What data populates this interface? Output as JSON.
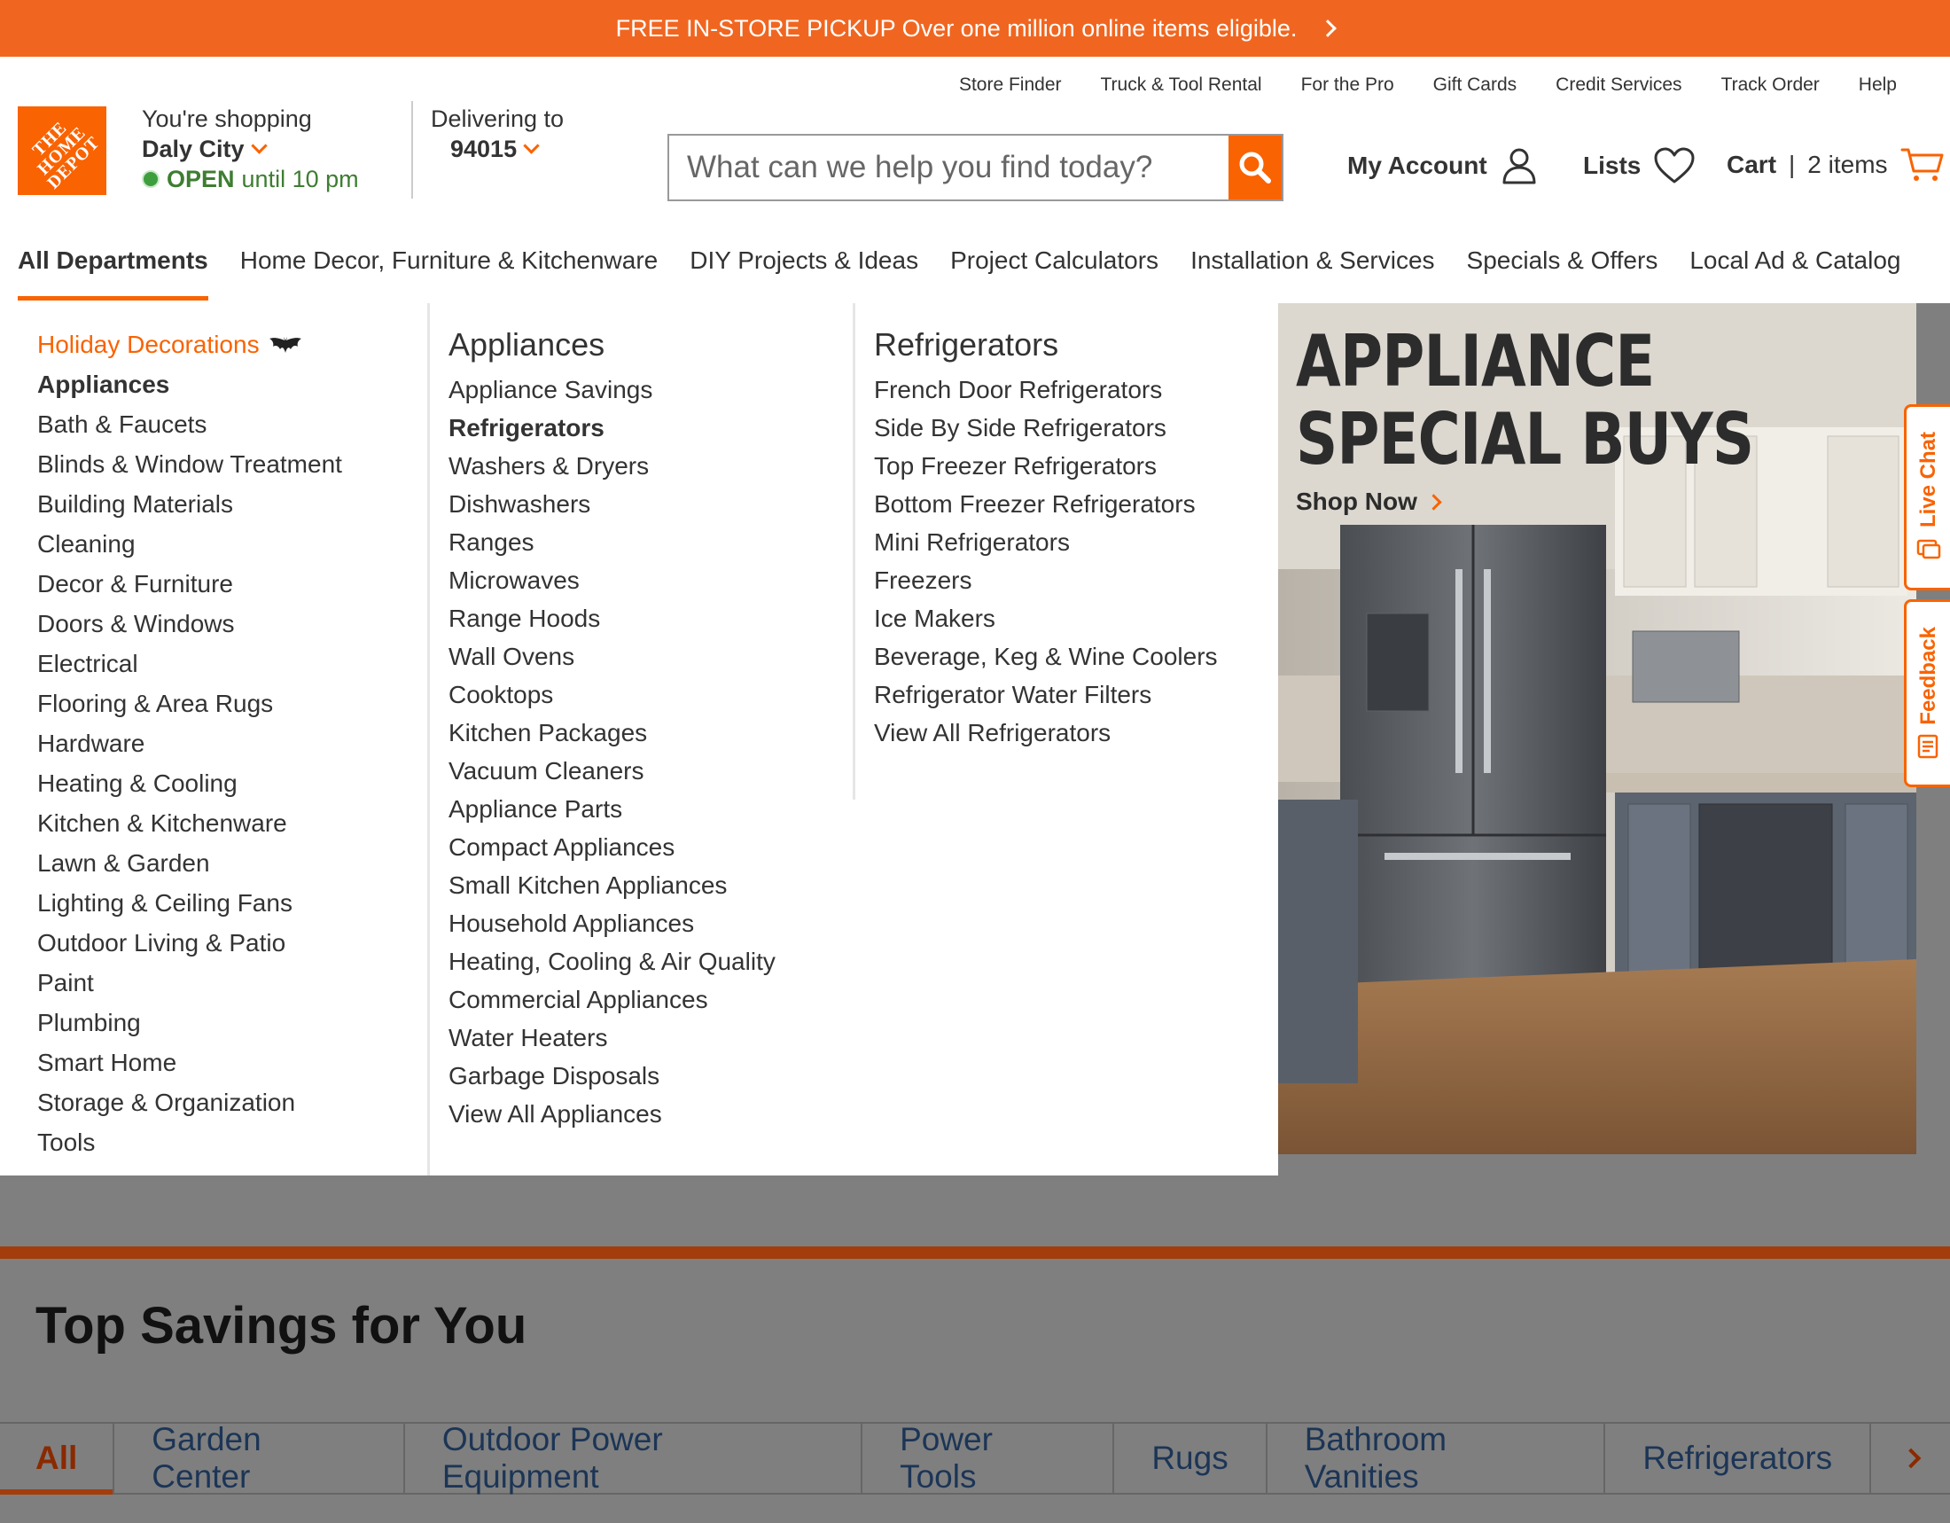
{
  "promo_bar": {
    "text": "FREE IN-STORE PICKUP Over one million online items eligible."
  },
  "utility_links": [
    "Store Finder",
    "Truck & Tool Rental",
    "For the Pro",
    "Gift Cards",
    "Credit Services",
    "Track Order",
    "Help"
  ],
  "logo": {
    "text": "THE HOME DEPOT"
  },
  "store": {
    "label": "You're shopping",
    "city": "Daly City",
    "status": "OPEN",
    "hours": "until 10 pm"
  },
  "delivery": {
    "label": "Delivering to",
    "zip": "94015"
  },
  "search": {
    "placeholder": "What can we help you find today?"
  },
  "account": {
    "my_account": "My Account",
    "lists": "Lists",
    "cart": "Cart",
    "cart_sep": "|",
    "cart_count": "2 items"
  },
  "nav": [
    "All Departments",
    "Home Decor, Furniture & Kitchenware",
    "DIY Projects & Ideas",
    "Project Calculators",
    "Installation & Services",
    "Specials & Offers",
    "Local Ad & Catalog"
  ],
  "departments": [
    "Holiday Decorations",
    "Appliances",
    "Bath & Faucets",
    "Blinds & Window Treatment",
    "Building Materials",
    "Cleaning",
    "Decor & Furniture",
    "Doors & Windows",
    "Electrical",
    "Flooring & Area Rugs",
    "Hardware",
    "Heating & Cooling",
    "Kitchen & Kitchenware",
    "Lawn & Garden",
    "Lighting & Ceiling Fans",
    "Outdoor Living & Patio",
    "Paint",
    "Plumbing",
    "Smart Home",
    "Storage & Organization",
    "Tools"
  ],
  "appliances": {
    "heading": "Appliances",
    "items": [
      "Appliance Savings",
      "Refrigerators",
      "Washers & Dryers",
      "Dishwashers",
      "Ranges",
      "Microwaves",
      "Range Hoods",
      "Wall Ovens",
      "Cooktops",
      "Kitchen Packages",
      "Vacuum Cleaners",
      "Appliance Parts",
      "Compact Appliances",
      "Small Kitchen Appliances",
      "Household Appliances",
      "Heating, Cooling & Air Quality",
      "Commercial Appliances",
      "Water Heaters",
      "Garbage Disposals",
      "View All Appliances"
    ]
  },
  "refrigerators": {
    "heading": "Refrigerators",
    "items": [
      "French Door Refrigerators",
      "Side By Side Refrigerators",
      "Top Freezer Refrigerators",
      "Bottom Freezer Refrigerators",
      "Mini Refrigerators",
      "Freezers",
      "Ice Makers",
      "Beverage, Keg & Wine Coolers",
      "Refrigerator Water Filters",
      "View All Refrigerators"
    ]
  },
  "promo_image": {
    "line1": "APPLIANCE",
    "line2": "SPECIAL BUYS",
    "cta": "Shop Now"
  },
  "side_tabs": {
    "live_chat": "Live Chat",
    "feedback": "Feedback"
  },
  "savings": {
    "title": "Top Savings for You",
    "tabs": [
      "All",
      "Garden Center",
      "Outdoor Power Equipment",
      "Power Tools",
      "Rugs",
      "Bathroom Vanities",
      "Refrigerators"
    ]
  },
  "colors": {
    "brand_orange": "#f96302",
    "open_green": "#3e7d32",
    "overlay_gray": "#7f7f7f"
  }
}
